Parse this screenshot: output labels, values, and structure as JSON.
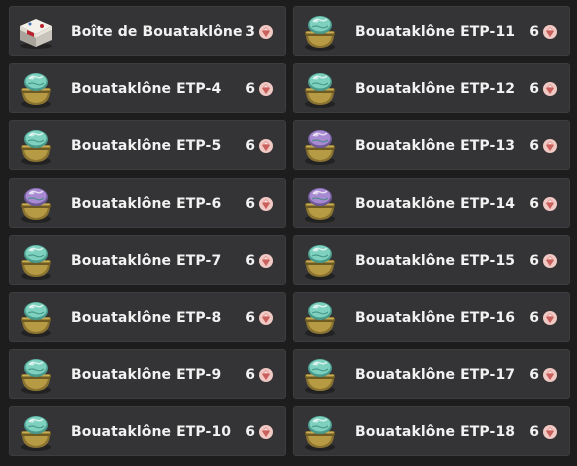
{
  "colors": {
    "background": "#1d1d1e",
    "card": "#343436",
    "text": "#f2f2f2",
    "gem": "#e8a9a4",
    "dome_teal": "#7fd1bf",
    "dome_purple": "#a88ad3",
    "pot_gold": "#a58c3c"
  },
  "columns": [
    {
      "items": [
        {
          "label": "Boîte de Bouataklône",
          "qty": "3",
          "icon": "white-gift-box-icon"
        },
        {
          "label": "Bouataklône ETP-4",
          "qty": "6",
          "icon": "teal-dome-pot-icon"
        },
        {
          "label": "Bouataklône ETP-5",
          "qty": "6",
          "icon": "teal-dome-pot-icon"
        },
        {
          "label": "Bouataklône ETP-6",
          "qty": "6",
          "icon": "purple-dome-pot-icon"
        },
        {
          "label": "Bouataklône ETP-7",
          "qty": "6",
          "icon": "teal-dome-pot-icon"
        },
        {
          "label": "Bouataklône ETP-8",
          "qty": "6",
          "icon": "teal-dome-pot-icon"
        },
        {
          "label": "Bouataklône ETP-9",
          "qty": "6",
          "icon": "teal-dome-pot-icon"
        },
        {
          "label": "Bouataklône ETP-10",
          "qty": "6",
          "icon": "teal-dome-pot-icon"
        }
      ]
    },
    {
      "items": [
        {
          "label": "Bouataklône ETP-11",
          "qty": "6",
          "icon": "teal-dome-pot-icon"
        },
        {
          "label": "Bouataklône ETP-12",
          "qty": "6",
          "icon": "teal-dome-pot-icon"
        },
        {
          "label": "Bouataklône ETP-13",
          "qty": "6",
          "icon": "purple-dome-pot-icon"
        },
        {
          "label": "Bouataklône ETP-14",
          "qty": "6",
          "icon": "purple-dome-pot-icon"
        },
        {
          "label": "Bouataklône ETP-15",
          "qty": "6",
          "icon": "teal-dome-pot-icon"
        },
        {
          "label": "Bouataklône ETP-16",
          "qty": "6",
          "icon": "teal-dome-pot-icon"
        },
        {
          "label": "Bouataklône ETP-17",
          "qty": "6",
          "icon": "teal-dome-pot-icon"
        },
        {
          "label": "Bouataklône ETP-18",
          "qty": "6",
          "icon": "teal-dome-pot-icon"
        }
      ]
    }
  ],
  "qty_currency_icon": "pink-gem-icon"
}
